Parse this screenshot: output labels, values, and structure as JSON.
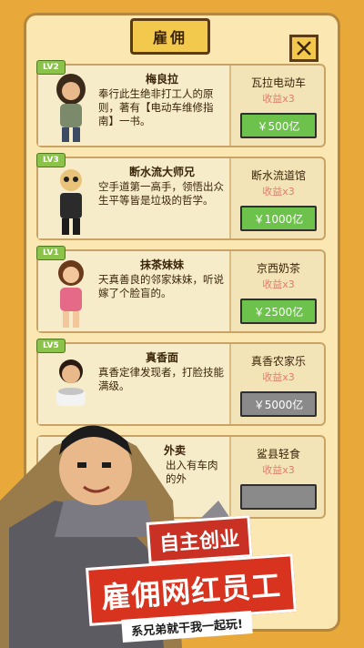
{
  "header": {
    "title": "雇佣"
  },
  "cards": [
    {
      "level": "LV2",
      "name": "梅良拉",
      "desc": "奉行此生绝非打工人的原则，著有【电动车维修指南】一书。",
      "shop": "瓦拉电动车",
      "gain": "收益x3",
      "price": "￥500亿",
      "state": "on"
    },
    {
      "level": "LV3",
      "name": "断水流大师兄",
      "desc": "空手道第一高手，领悟出众生平等皆是垃圾的哲学。",
      "shop": "断水流道馆",
      "gain": "收益x3",
      "price": "￥1000亿",
      "state": "on"
    },
    {
      "level": "LV1",
      "name": "抹茶妹妹",
      "desc": "天真善良的邻家妹妹，听说嫁了个脸盲的。",
      "shop": "京西奶茶",
      "gain": "收益x3",
      "price": "￥2500亿",
      "state": "on"
    },
    {
      "level": "LV5",
      "name": "真香面",
      "desc": "真香定律发现者，打脸技能满级。",
      "shop": "真香农家乐",
      "gain": "收益x3",
      "price": "￥5000亿",
      "state": "off"
    },
    {
      "level": "",
      "name": "外卖",
      "desc": "出入有车肉的外",
      "shop": "鲨县轻食",
      "gain": "收益x3",
      "price": "",
      "state": "off"
    }
  ],
  "promo": {
    "line1": "自主创业",
    "line2": "雇佣网红员工",
    "line3": "系兄弟就干我一起玩!"
  },
  "colors": {
    "accent": "#f2c94c",
    "buy_on": "#6cc24a",
    "buy_off": "#8a8a8a",
    "gain": "#e87a6a"
  }
}
